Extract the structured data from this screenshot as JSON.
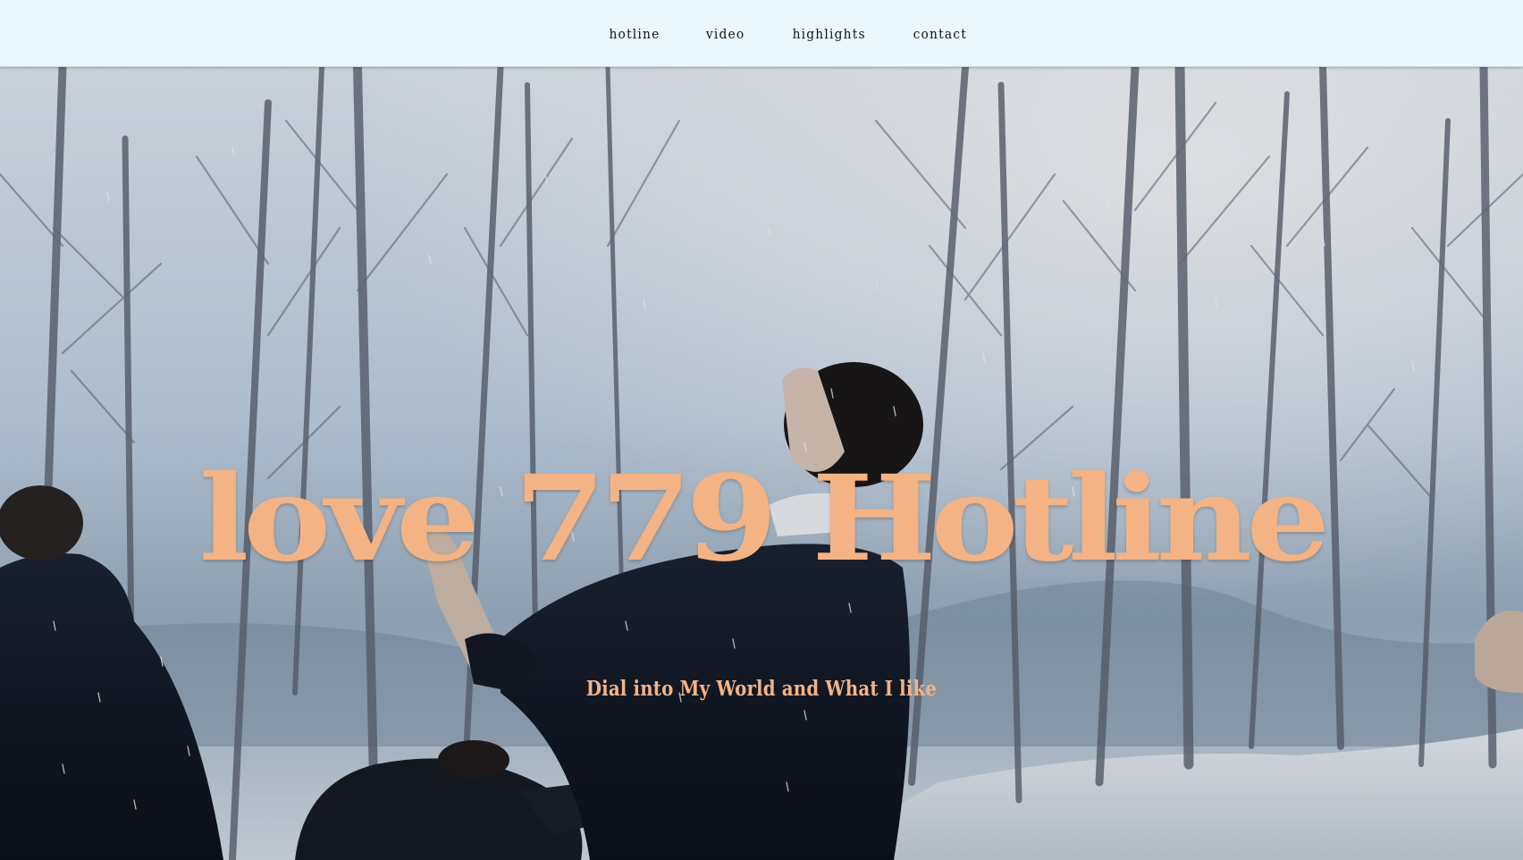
{
  "nav": {
    "items": [
      {
        "label": "hotline"
      },
      {
        "label": "video"
      },
      {
        "label": "highlights"
      },
      {
        "label": "contact"
      }
    ]
  },
  "hero": {
    "title": "love 779 Hotline",
    "subtitle": "Dial into My World and What I like",
    "image_icon": "snowy-forest-photo",
    "carousel": {
      "slide_count": 3,
      "active_index": 1
    }
  },
  "colors": {
    "nav_background": "#eaf8fd",
    "nav_text": "#111111",
    "accent_peach": "#f4b384",
    "dot_active": "#ffffff",
    "dot_inactive": "#8c8c8c"
  }
}
